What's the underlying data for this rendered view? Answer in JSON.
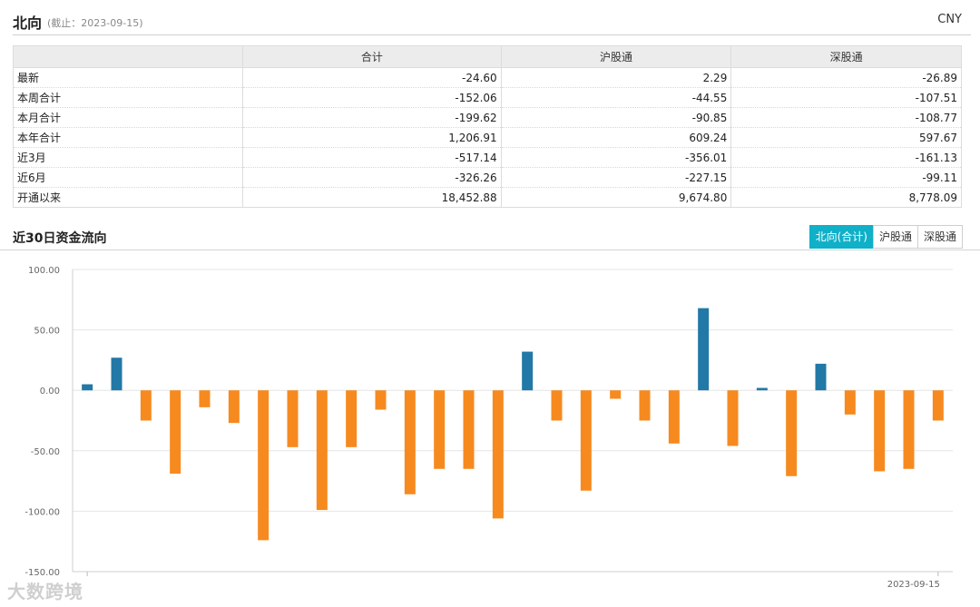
{
  "header": {
    "title": "北向",
    "date_note": "(截止：2023-09-15)",
    "currency": "CNY"
  },
  "table": {
    "columns": [
      "",
      "合计",
      "沪股通",
      "深股通"
    ],
    "rows": [
      [
        "最新",
        "-24.60",
        "2.29",
        "-26.89"
      ],
      [
        "本周合计",
        "-152.06",
        "-44.55",
        "-107.51"
      ],
      [
        "本月合计",
        "-199.62",
        "-90.85",
        "-108.77"
      ],
      [
        "本年合计",
        "1,206.91",
        "609.24",
        "597.67"
      ],
      [
        "近3月",
        "-517.14",
        "-356.01",
        "-161.13"
      ],
      [
        "近6月",
        "-326.26",
        "-227.15",
        "-99.11"
      ],
      [
        "开通以来",
        "18,452.88",
        "9,674.80",
        "8,778.09"
      ]
    ]
  },
  "section": {
    "title": "近30日资金流向",
    "tabs": [
      "北向(合计)",
      "沪股通",
      "深股通"
    ],
    "active_tab": 0
  },
  "watermark": "大数跨境",
  "colors": {
    "positive": "#2278a6",
    "negative": "#f68a1f",
    "tab_active": "#0fb0c8"
  },
  "chart_data": {
    "type": "bar",
    "ylim": [
      -150,
      100
    ],
    "y_ticks": [
      "100.00",
      "50.00",
      "0.00",
      "-50.00",
      "-100.00",
      "-150.00"
    ],
    "x_tick_labels": [
      "",
      "2023-09-15"
    ],
    "values": [
      5,
      27,
      -25,
      -69,
      -14,
      -27,
      -124,
      -47,
      -99,
      -47,
      -16,
      -86,
      -65,
      -65,
      -106,
      32,
      -25,
      -83,
      -7,
      -25,
      -44,
      68,
      -46,
      2,
      -71,
      22,
      -20,
      -67,
      -65,
      -25
    ],
    "grid": true
  }
}
